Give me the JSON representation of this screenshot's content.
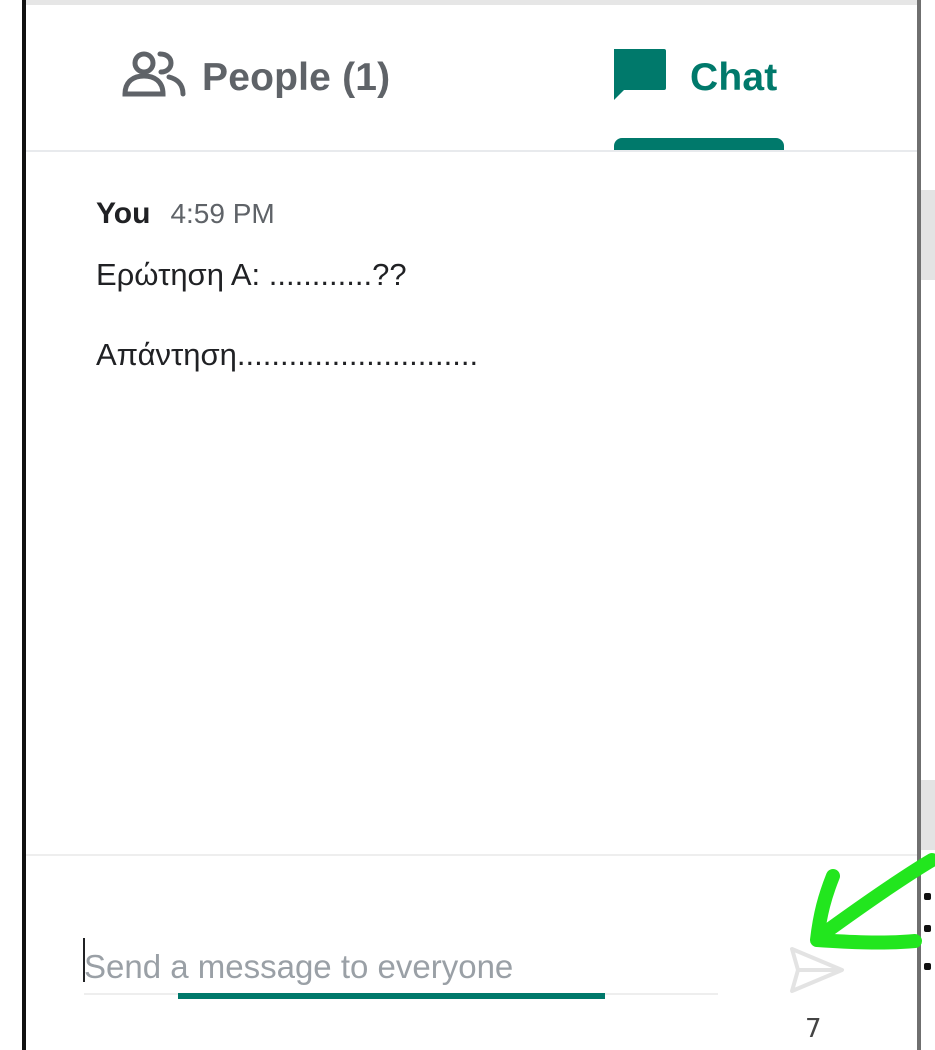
{
  "tabs": {
    "people": {
      "label": "People (1)",
      "icon": "people-icon"
    },
    "chat": {
      "label": "Chat",
      "icon": "chat-bubble-icon",
      "active": true
    }
  },
  "message": {
    "sender": "You",
    "time": "4:59 PM",
    "lines": [
      "Ερώτηση Α: ............??",
      "Απάντηση............................"
    ]
  },
  "composer": {
    "placeholder": "Send a message to everyone",
    "value": "",
    "send_icon": "send-icon"
  },
  "page_number": "7",
  "colors": {
    "accent": "#00796b",
    "annotation": "#22e61e",
    "muted_text": "#5f6368",
    "text": "#202124"
  }
}
